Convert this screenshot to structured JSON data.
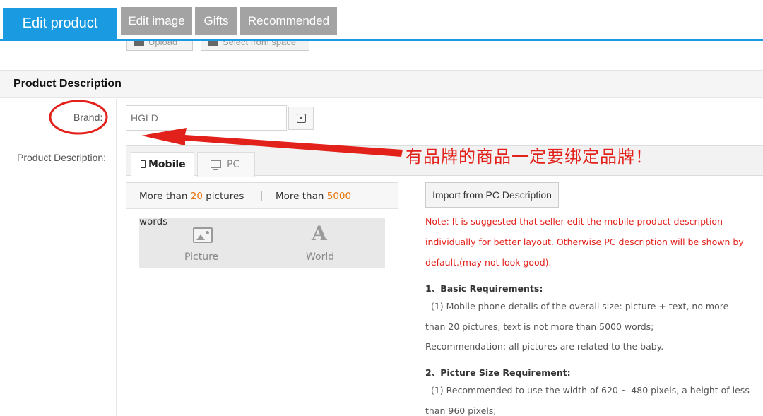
{
  "tabs": {
    "edit_product": "Edit product",
    "edit_image": "Edit image",
    "gifts": "Gifts",
    "recommended": "Recommended"
  },
  "upload": {
    "upload_label": "Upload",
    "select_label": "Select from space"
  },
  "section": {
    "title": "Product Description"
  },
  "brand": {
    "label": "Brand:",
    "value": "HGLD"
  },
  "description": {
    "label": "Product Description:",
    "tabs": {
      "mobile": "Mobile",
      "pc": "PC"
    },
    "limits": {
      "pictures_prefix": "More than ",
      "pictures_count": "20",
      "pictures_suffix": " pictures",
      "words_prefix": "More than ",
      "words_count": "5000",
      "words_wrap": "words"
    },
    "insert": {
      "picture": "Picture",
      "text": "World"
    },
    "import_button": "Import from PC Description",
    "note_lines": [
      "Note: It is suggested that seller edit the mobile product description",
      "individually for better layout. Otherwise PC description will be shown by",
      "default.(may not look good)."
    ],
    "requirements": [
      "1、Basic Requirements:",
      "  (1) Mobile phone details of the overall size: picture + text, no more",
      "than 20 pictures, text is not more than 5000 words;",
      "Recommendation: all pictures are related to the baby.",
      "2、Picture Size Requirement:",
      "  (1) Recommended to use the width of 620 ~ 480 pixels, a height of less",
      "than 960 pixels;"
    ]
  },
  "annotation": {
    "text": "有品牌的商品一定要绑定品牌！",
    "color": "#e3211b"
  },
  "colors": {
    "accent": "#1a9ae0",
    "tab_inactive": "#a3a3a3",
    "highlight": "#e8760d",
    "warning": "#e3211b"
  }
}
